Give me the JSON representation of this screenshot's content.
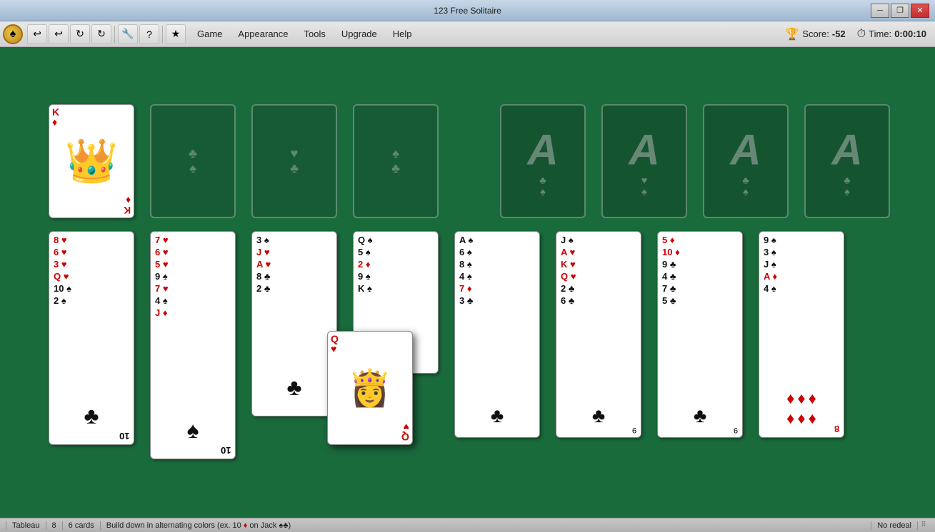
{
  "window": {
    "title": "123 Free Solitaire",
    "controls": {
      "minimize": "─",
      "restore": "❐",
      "close": "✕"
    }
  },
  "toolbar": {
    "buttons": [
      "↩",
      "↩",
      "↻",
      "↻",
      "🔧",
      "?",
      "★"
    ],
    "menu_items": [
      "Game",
      "Appearance",
      "Tools",
      "Upgrade",
      "Help"
    ]
  },
  "score": {
    "label": "Score:",
    "value": "-52"
  },
  "time": {
    "label": "Time:",
    "value": "0:00:10"
  },
  "status_bar": {
    "game_type": "Tableau",
    "columns": "8",
    "cards": "6 cards",
    "rule": "Build down in alternating colors (ex. 10 ♦ on Jack ♠♣)",
    "redeal": "No redeal"
  }
}
